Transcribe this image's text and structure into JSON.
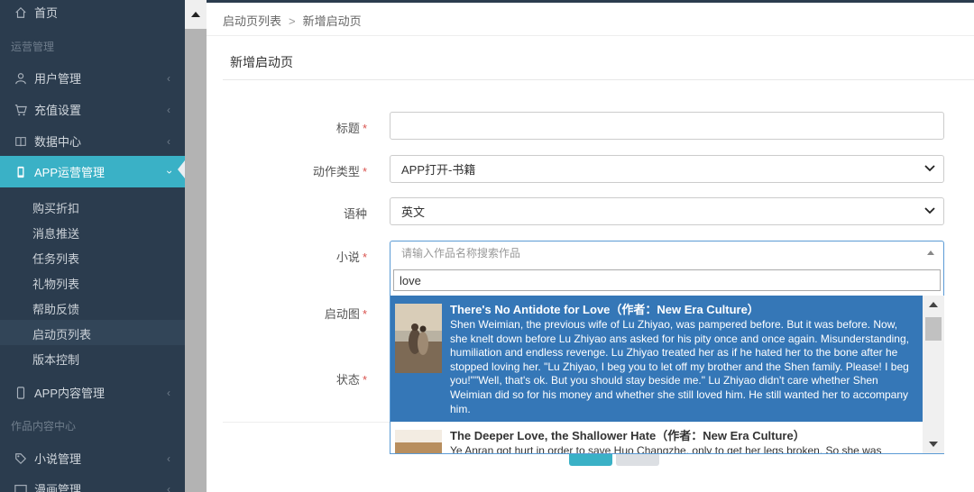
{
  "sidebar": {
    "home": "首页",
    "section_ops": "运营管理",
    "user_mgmt": "用户管理",
    "recharge": "充值设置",
    "data_center": "数据中心",
    "app_ops": "APP运营管理",
    "sub_items": [
      "购买折扣",
      "消息推送",
      "任务列表",
      "礼物列表",
      "帮助反馈",
      "启动页列表",
      "版本控制"
    ],
    "app_content": "APP内容管理",
    "section_content": "作品内容中心",
    "novel_mgmt": "小说管理",
    "comic_mgmt": "漫画管理"
  },
  "breadcrumb": {
    "parent": "启动页列表",
    "separator": ">",
    "current": "新增启动页"
  },
  "panel_title": "新增启动页",
  "form": {
    "title_label": "标题",
    "title_value": "",
    "action_label": "动作类型",
    "action_value": "APP打开-书籍",
    "lang_label": "语种",
    "lang_value": "英文",
    "novel_label": "小说",
    "novel_placeholder": "请输入作品名称搜索作品",
    "image_label": "启动图",
    "status_label": "状态",
    "required_mark": "*"
  },
  "dropdown": {
    "search_value": "love",
    "results": [
      {
        "title": "There's No Antidote for Love（作者：New Era Culture）",
        "desc": "Shen Weimian, the previous wife of Lu Zhiyao, was pampered before. But it was before. Now, she knelt down before Lu Zhiyao ans asked for his pity once and once again. Misunderstanding, humiliation and endless revenge. Lu Zhiyao treated her as if he hated her to the bone after he stopped loving her. \"Lu Zhiyao, I beg you to let off my brother and the Shen family. Please! I beg you!\"\"Well, that's ok. But you should stay beside me.\" Lu Zhiyao didn't care whether Shen Weimian did so for his money and whether she still loved him. He still wanted her to accompany him."
      },
      {
        "title": "The Deeper Love, the Shallower Hate（作者：New Era Culture）",
        "desc": "Ye Anran got hurt in order to save Huo Changzhe, only to get her legs broken. So she was"
      }
    ]
  },
  "colors": {
    "sidebar_bg": "#2b3c4e",
    "accent": "#3ab1c6",
    "highlight": "#3577b7",
    "required": "#d9534f"
  }
}
